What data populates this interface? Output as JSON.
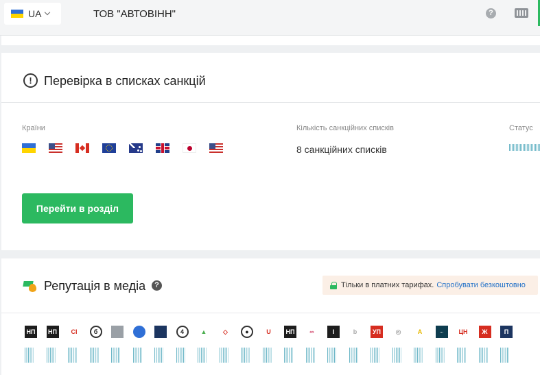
{
  "header": {
    "lang_code": "UA",
    "company_name": "ТОВ \"АВТОВІНН\"",
    "help_glyph": "?"
  },
  "sanctions": {
    "title": "Перевірка в списках санкцій",
    "icon_glyph": "!",
    "countries_label": "Країни",
    "count_label": "Кількість санкційних списків",
    "status_label": "Статус",
    "count_value": "8 санкційних списків",
    "flags": [
      "ukraine-flag-icon",
      "usa-flag-icon",
      "canada-flag-icon",
      "eu-flag-icon",
      "australia-flag-icon",
      "uk-flag-icon",
      "japan-flag-icon",
      "usa-flag-icon"
    ],
    "button_label": "Перейти в розділ"
  },
  "media": {
    "title": "Репутація в медіа",
    "info_glyph": "?",
    "promo_text": "Тільки в платних тарифах.",
    "promo_link": "Спробувати безкоштовно",
    "logos": [
      {
        "name": "media-logo-1",
        "glyph": "НП"
      },
      {
        "name": "media-logo-2",
        "glyph": "НП"
      },
      {
        "name": "media-logo-3",
        "glyph": "CI"
      },
      {
        "name": "media-logo-4",
        "glyph": "б"
      },
      {
        "name": "media-logo-5",
        "glyph": ""
      },
      {
        "name": "media-logo-6",
        "glyph": ""
      },
      {
        "name": "media-logo-7",
        "glyph": ""
      },
      {
        "name": "media-logo-8",
        "glyph": "4"
      },
      {
        "name": "media-logo-9",
        "glyph": "▲"
      },
      {
        "name": "media-logo-10",
        "glyph": "◇"
      },
      {
        "name": "media-logo-11",
        "glyph": "●"
      },
      {
        "name": "media-logo-12",
        "glyph": "U"
      },
      {
        "name": "media-logo-13",
        "glyph": "НП"
      },
      {
        "name": "media-logo-14",
        "glyph": "∞"
      },
      {
        "name": "media-logo-15",
        "glyph": "I"
      },
      {
        "name": "media-logo-16",
        "glyph": "b"
      },
      {
        "name": "media-logo-17",
        "glyph": "УП"
      },
      {
        "name": "media-logo-18",
        "glyph": "◎"
      },
      {
        "name": "media-logo-19",
        "glyph": "A"
      },
      {
        "name": "media-logo-20",
        "glyph": "..."
      },
      {
        "name": "media-logo-21",
        "glyph": "ЦН"
      },
      {
        "name": "media-logo-22",
        "glyph": "Ж"
      },
      {
        "name": "media-logo-23",
        "glyph": "П"
      }
    ]
  },
  "colors": {
    "accent_green": "#2cb960",
    "link_blue": "#2472c8",
    "promo_bg": "#fbefe6"
  }
}
